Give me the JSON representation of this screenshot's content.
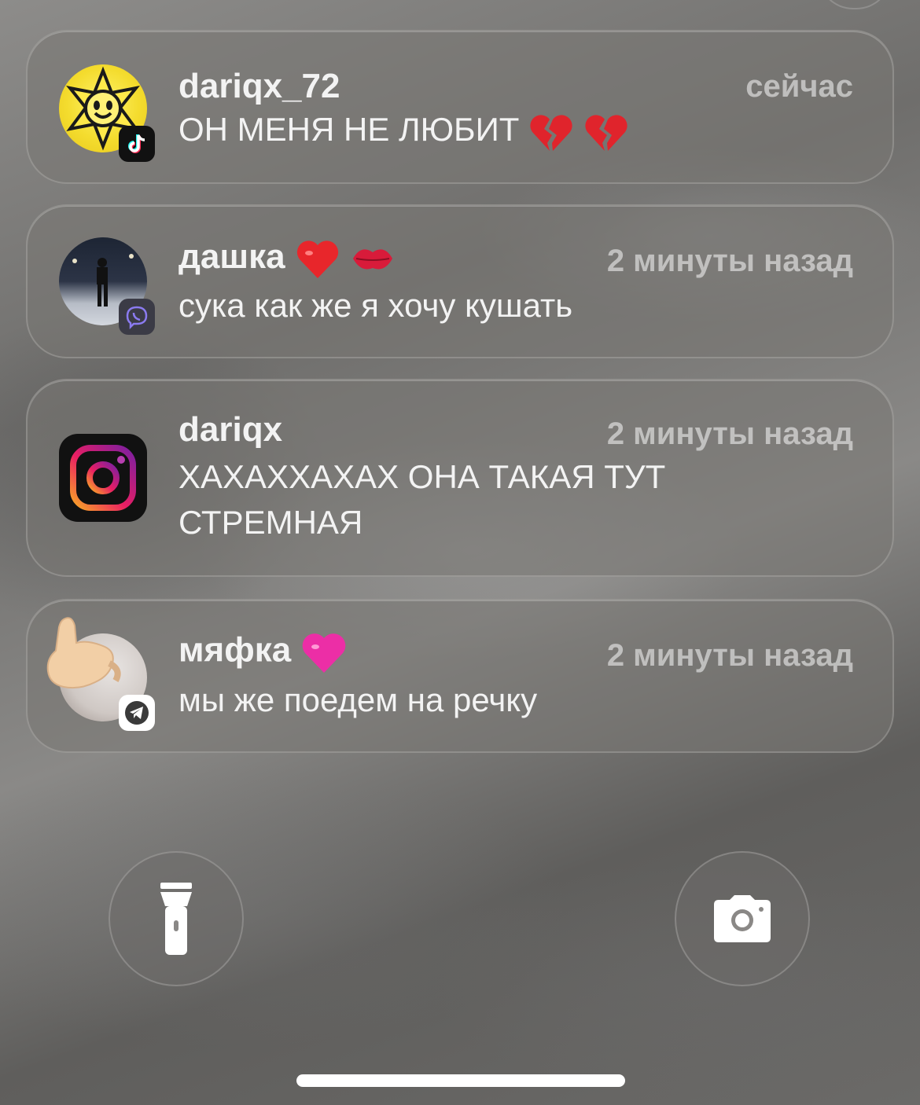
{
  "notifications": [
    {
      "sender": "dariqx_72",
      "time": "сейчас",
      "message": "ОН МЕНЯ НЕ ЛЮБИТ",
      "message_emoji": [
        "broken-heart",
        "broken-heart"
      ],
      "app": "tiktok"
    },
    {
      "sender": "дашка",
      "sender_emoji": [
        "red-heart",
        "kiss-mark"
      ],
      "time": "2 минуты назад",
      "message": "сука как же я хочу кушать",
      "app": "viber"
    },
    {
      "sender": "dariqx",
      "time": "2 минуты назад",
      "message": "ХАХАХХАХАХ ОНА ТАКАЯ ТУТ СТРЕМНАЯ",
      "app": "instagram"
    },
    {
      "sender": "мяфка",
      "sender_emoji": [
        "pink-heart"
      ],
      "time": "2 минуты назад",
      "message": "мы же поедем на речку",
      "app": "telegram"
    }
  ],
  "quick_actions": {
    "left": "flashlight-icon",
    "right": "camera-icon"
  },
  "colors": {
    "tiktok_badge": "#111111",
    "viber_badge": "#3b3b46",
    "telegram_badge": "#ffffff",
    "text": "#f3f3f3"
  }
}
